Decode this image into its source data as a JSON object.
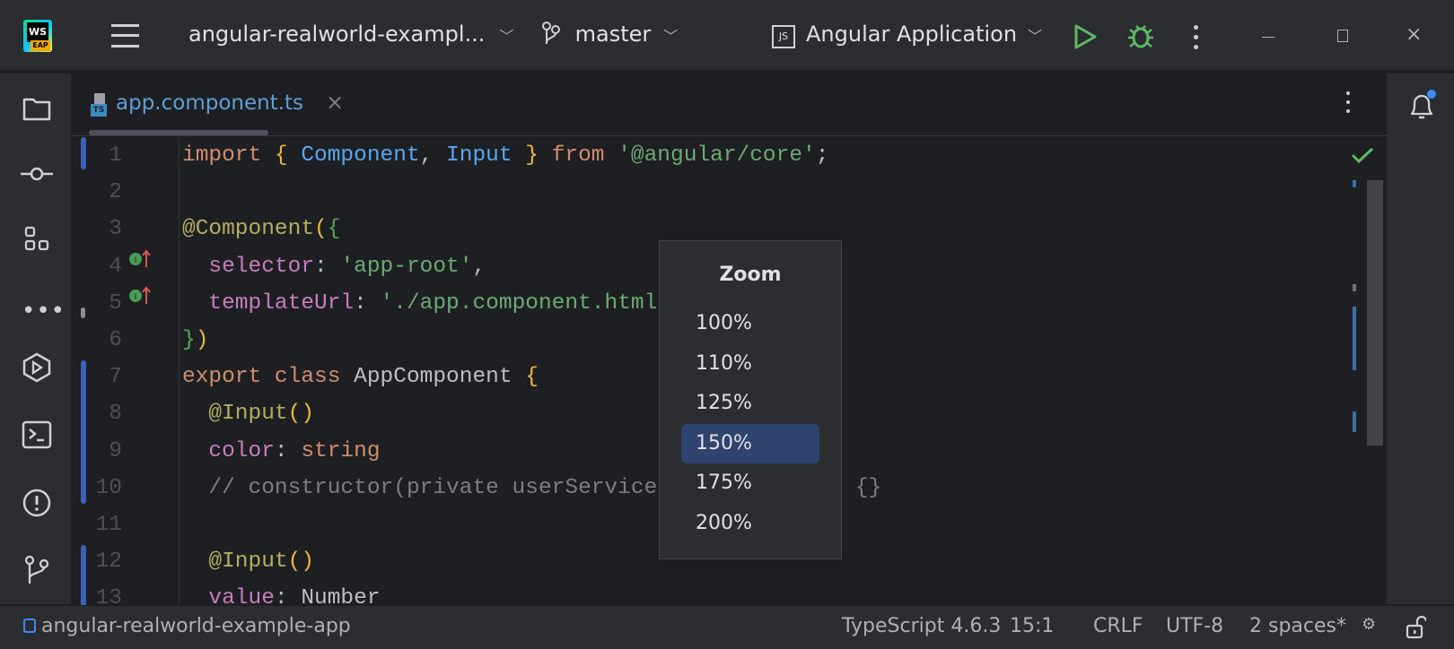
{
  "titlebar": {
    "logo_text": "WS",
    "logo_badge": "EAP",
    "project": "angular-realworld-exampl...",
    "branch": "master",
    "run_config": "Angular Application",
    "run_config_icon": "JS"
  },
  "tab": {
    "label": "app.component.ts",
    "icon": "TS"
  },
  "code_lines": [
    {
      "n": "1",
      "t": [
        [
          "kw",
          "import "
        ],
        [
          "br",
          "{ "
        ],
        [
          "cls",
          "Component"
        ],
        [
          "pl",
          ", "
        ],
        [
          "cls",
          "Input"
        ],
        [
          "br",
          " } "
        ],
        [
          "kw",
          "from "
        ],
        [
          "str",
          "'@angular/core'"
        ],
        [
          "pl",
          ";"
        ]
      ]
    },
    {
      "n": "2",
      "t": []
    },
    {
      "n": "3",
      "t": [
        [
          "ann",
          "@Component"
        ],
        [
          "br",
          "("
        ],
        [
          "br2",
          "{"
        ]
      ]
    },
    {
      "n": "4",
      "t": [
        [
          "pl",
          "  "
        ],
        [
          "prop",
          "selector"
        ],
        [
          "pl",
          ": "
        ],
        [
          "str",
          "'app-root'"
        ],
        [
          "pl",
          ","
        ]
      ]
    },
    {
      "n": "5",
      "t": [
        [
          "pl",
          "  "
        ],
        [
          "prop",
          "templateUrl"
        ],
        [
          "pl",
          ": "
        ],
        [
          "str",
          "'./app.component.html'"
        ]
      ]
    },
    {
      "n": "6",
      "t": [
        [
          "br2",
          "}"
        ],
        [
          "br",
          ")"
        ]
      ]
    },
    {
      "n": "7",
      "t": [
        [
          "kw",
          "export class "
        ],
        [
          "pl",
          "AppComponent "
        ],
        [
          "br",
          "{"
        ]
      ]
    },
    {
      "n": "8",
      "t": [
        [
          "pl",
          "  "
        ],
        [
          "ann",
          "@Input"
        ],
        [
          "br",
          "()"
        ]
      ]
    },
    {
      "n": "9",
      "t": [
        [
          "pl",
          "  "
        ],
        [
          "prop",
          "color"
        ],
        [
          "pl",
          ": "
        ],
        [
          "kw",
          "string"
        ]
      ]
    },
    {
      "n": "10",
      "t": [
        [
          "pl",
          "  "
        ],
        [
          "cm",
          "// constructor(private userService: UserService) {}"
        ]
      ]
    },
    {
      "n": "11",
      "t": []
    },
    {
      "n": "12",
      "t": [
        [
          "pl",
          "  "
        ],
        [
          "ann",
          "@Input"
        ],
        [
          "br",
          "()"
        ]
      ]
    },
    {
      "n": "13",
      "t": [
        [
          "pl",
          "  "
        ],
        [
          "prop",
          "value"
        ],
        [
          "pl",
          ": "
        ],
        [
          "pl",
          "Number"
        ]
      ]
    }
  ],
  "zoom_popup": {
    "title": "Zoom",
    "options": [
      "100%",
      "110%",
      "125%",
      "150%",
      "175%",
      "200%"
    ],
    "selected": "150%"
  },
  "statusbar": {
    "project": "angular-realworld-example-app",
    "language": "TypeScript 4.6.3",
    "position": "15:1",
    "line_sep": "CRLF",
    "encoding": "UTF-8",
    "indent": "2 spaces*"
  }
}
